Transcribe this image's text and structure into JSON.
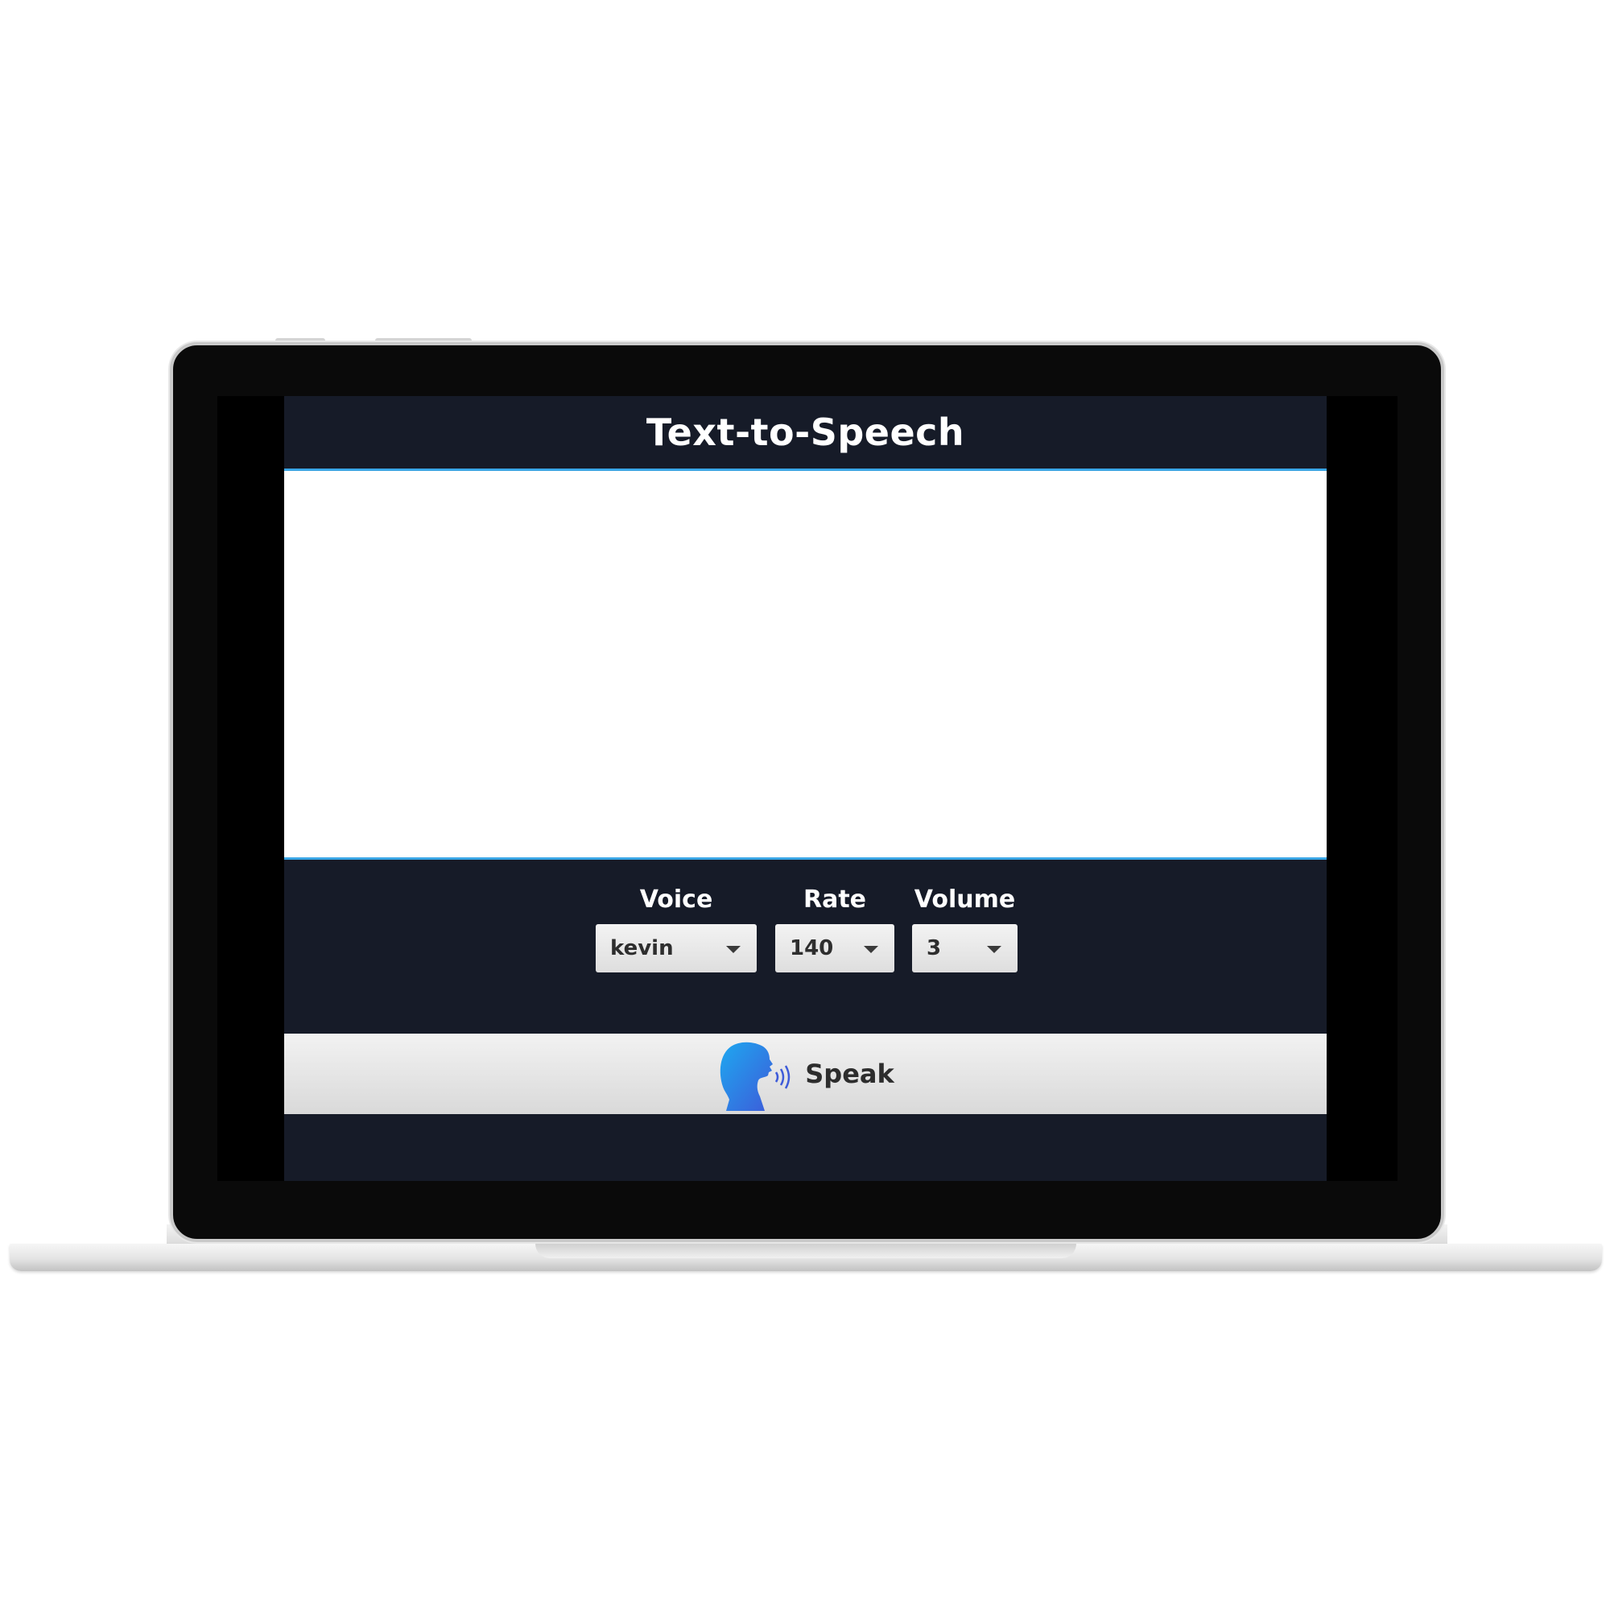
{
  "app": {
    "title": "Text-to-Speech",
    "text_area": {
      "value": "",
      "placeholder": ""
    }
  },
  "controls": {
    "voice": {
      "label": "Voice",
      "value": "kevin"
    },
    "rate": {
      "label": "Rate",
      "value": "140"
    },
    "volume": {
      "label": "Volume",
      "value": "3"
    }
  },
  "speak_button": {
    "label": "Speak",
    "icon": "speaking-head-icon"
  },
  "colors": {
    "app_background": "#161b28",
    "accent_border": "#3aa6e6",
    "icon_gradient_start": "#1ea8f0",
    "icon_gradient_end": "#3d5bd9"
  }
}
